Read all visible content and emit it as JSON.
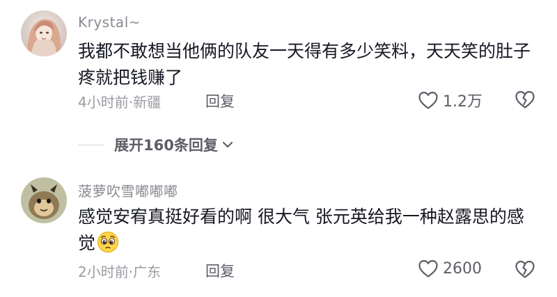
{
  "comments": [
    {
      "username": "Krystal~",
      "text": "我都不敢想当他俩的队友一天得有多少笑料，天天笑的肚子疼就把钱赚了",
      "meta": "4小时前·新疆",
      "reply_label": "回复",
      "like_count": "1.2万",
      "avatar_icon": "avatar-photo",
      "like_icon": "heart-outline-icon",
      "dislike_icon": "broken-heart-icon"
    },
    {
      "username": "菠萝吹雪嘟嘟嘟",
      "text": "感觉安宥真挺好看的啊 很大气 张元英给我一种赵露思的感觉",
      "emoji": "pleading-face-emoji",
      "meta": "2小时前·广东",
      "reply_label": "回复",
      "like_count": "2600",
      "avatar_icon": "avatar-photo",
      "like_icon": "heart-outline-icon",
      "dislike_icon": "broken-heart-icon"
    }
  ],
  "expand_replies": {
    "label": "展开160条回复",
    "chevron_icon": "chevron-down-icon"
  },
  "colors": {
    "text_primary": "#161823",
    "text_secondary": "#8a8b91",
    "action_text": "#5c5d66"
  }
}
